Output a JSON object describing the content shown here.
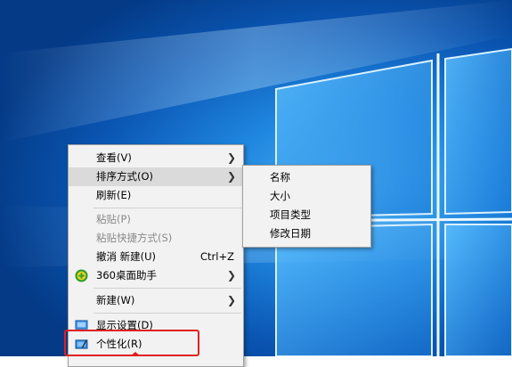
{
  "context_menu": {
    "items": [
      {
        "label": "查看(V)",
        "submenu": true
      },
      {
        "label": "排序方式(O)",
        "submenu": true,
        "hovered": true
      },
      {
        "label": "刷新(E)"
      },
      {
        "label": "粘贴(P)",
        "disabled": true
      },
      {
        "label": "粘贴快捷方式(S)",
        "disabled": true
      },
      {
        "label": "撤消 新建(U)",
        "shortcut": "Ctrl+Z"
      },
      {
        "label": "360桌面助手",
        "submenu": true,
        "icon": "360-icon"
      },
      {
        "label": "新建(W)",
        "submenu": true
      },
      {
        "label": "显示设置(D)",
        "icon": "display-settings-icon"
      },
      {
        "label": "个性化(R)",
        "icon": "personalize-icon"
      }
    ]
  },
  "sort_submenu": {
    "items": [
      {
        "label": "名称"
      },
      {
        "label": "大小"
      },
      {
        "label": "项目类型"
      },
      {
        "label": "修改日期"
      }
    ]
  },
  "colors": {
    "menu_bg": "#f2f2f2",
    "hover_bg": "#dadada",
    "highlight_red": "#e02020",
    "wallpaper_blue": "#1f86df"
  }
}
